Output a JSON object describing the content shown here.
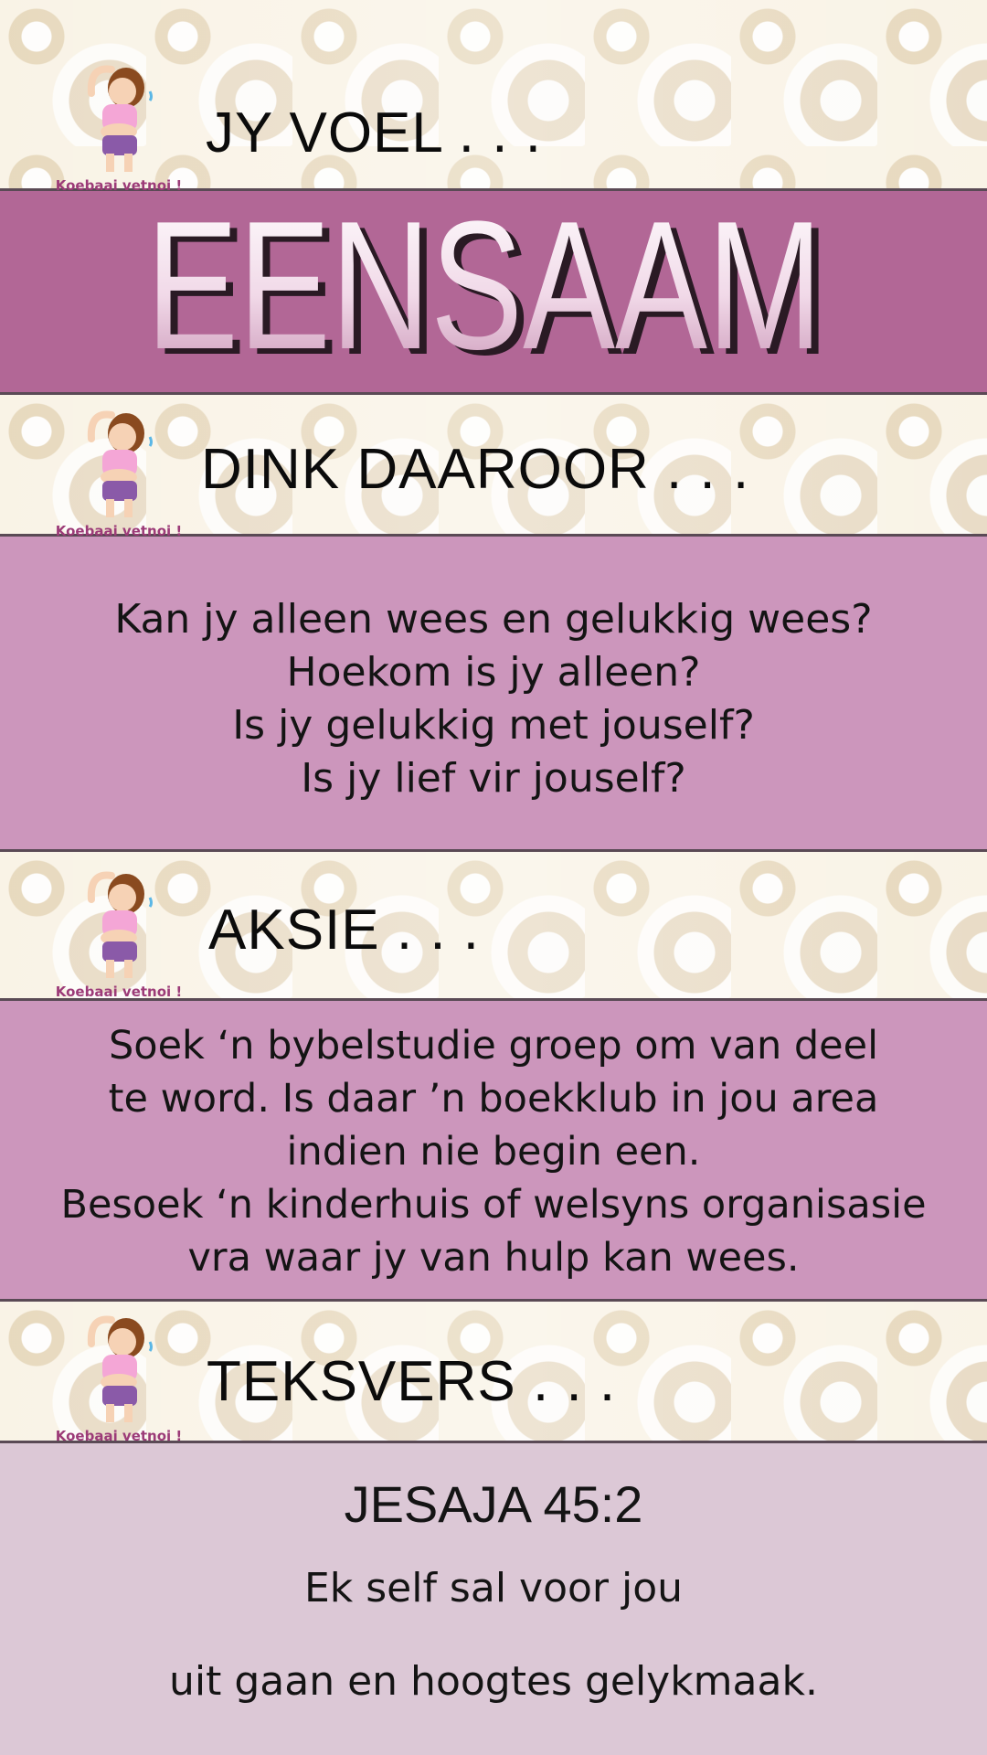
{
  "sections": {
    "feel": {
      "heading": "JY VOEL . . ."
    },
    "title": {
      "word": "EENSAAM"
    },
    "think": {
      "heading": "DINK DAAROOR . . .",
      "lines": [
        "Kan jy alleen wees en gelukkig wees?",
        "Hoekom is jy alleen?",
        "Is jy gelukkig met jouself?",
        "Is jy lief vir jouself?"
      ]
    },
    "action": {
      "heading": "AKSIE . . .",
      "lines": [
        "Soek ‘n bybelstudie groep om van deel",
        "te word.  Is daar ’n boekklub in jou area",
        "indien nie begin een.",
        "Besoek ‘n kinderhuis of welsyns organisasie",
        "vra waar jy van hulp kan wees."
      ]
    },
    "verse": {
      "heading": "TEKSVERS . . .",
      "reference": "JESAJA 45:2",
      "lines": [
        "Ek self sal voor jou",
        "uit gaan en hoogtes gelykmaak."
      ]
    }
  },
  "mascot": {
    "caption": "Koebaai vetnoi !",
    "icon": "stretching-woman-icon"
  },
  "colors": {
    "title_band": "#b26796",
    "text_band": "#cc96bc",
    "verse_band": "#dcc8d6",
    "mascot_caption": "#9c3b78"
  }
}
